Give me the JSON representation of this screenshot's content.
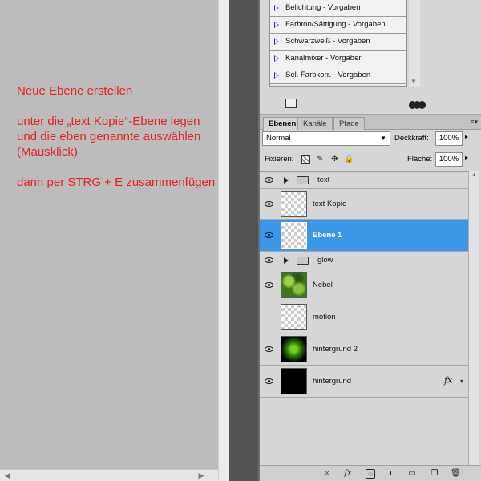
{
  "instructions": {
    "line1": "Neue Ebene erstellen",
    "line2": "unter die „text Kopie“-Ebene legen und die eben genannte auswählen (Mausklick)",
    "line3": "dann per STRG + E zusammenfügen"
  },
  "adjustments": {
    "items": [
      {
        "label": "Belichtung - Vorgaben"
      },
      {
        "label": "Farbton/Sättigung - Vorgaben"
      },
      {
        "label": "Schwarzweiß - Vorgaben"
      },
      {
        "label": "Kanalmixer - Vorgaben"
      },
      {
        "label": "Sel. Farbkorr. - Vorgaben"
      }
    ]
  },
  "tabs": [
    {
      "label": "Ebenen",
      "active": true
    },
    {
      "label": "Kanäle",
      "active": false
    },
    {
      "label": "Pfade",
      "active": false
    }
  ],
  "blend": {
    "mode": "Normal",
    "opacity_label": "Deckkraft:",
    "opacity_value": "100%",
    "lock_label": "Fixieren:",
    "fill_label": "Fläche:",
    "fill_value": "100%"
  },
  "layers": [
    {
      "name": "text",
      "kind": "group"
    },
    {
      "name": "text Kopie",
      "kind": "layer",
      "thumb": "transparent"
    },
    {
      "name": "Ebene 1",
      "kind": "layer",
      "thumb": "transparent",
      "selected": true
    },
    {
      "name": "glow",
      "kind": "group"
    },
    {
      "name": "Nebel",
      "kind": "layer",
      "thumb": "green-clouds"
    },
    {
      "name": "motion",
      "kind": "layer",
      "thumb": "transparent"
    },
    {
      "name": "hintergrund 2",
      "kind": "layer",
      "thumb": "green-glow"
    },
    {
      "name": "hintergrund",
      "kind": "layer",
      "thumb": "black",
      "fx": "fx"
    }
  ],
  "colors": {
    "instruction_text": "#e8201c",
    "selected_layer": "#3d97e8",
    "panel_bg": "#d6d6d6"
  }
}
